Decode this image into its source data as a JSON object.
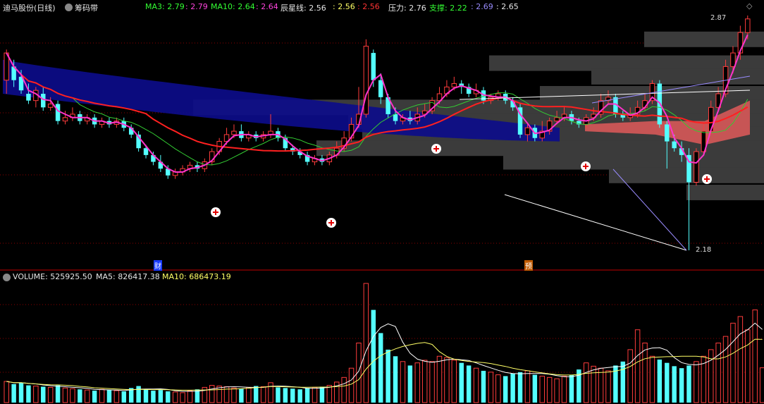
{
  "header": {
    "stock_name": "迪马股份(日线)",
    "indicator_name": "筹码带",
    "ma3_label": "MA3: 2.79",
    "ma3_value": ": 2.79",
    "ma10_label": "MA10: 2.64",
    "ma10_value": ": 2.64",
    "chenxing_label": "辰星线: 2.56",
    "chenxing_v1": ": 2.56",
    "chenxing_v2": ": 2.56",
    "pressure_label": "压力: 2.76",
    "support_label": "支撑: 2.22",
    "support_v1": ": 2.69",
    "support_v2": ": 2.65"
  },
  "volume_header": {
    "volume_label": "VOLUME: 525925.50",
    "ma5_label": "MA5: 826417.38",
    "ma10_label": "MA10: 686473.19"
  },
  "annotations": {
    "high_price": "2.87",
    "low_price": "2.18",
    "tag_cai": "财",
    "tag_yu": "预"
  },
  "colors": {
    "up": "#ff3c3c",
    "down": "#54ffff",
    "ma3": "#ff33cc",
    "ma10_green": "#33cc33",
    "chenxing": "#ff2020",
    "chip_band": "#0c0c8c",
    "volume_ma5": "#ffffff",
    "volume_ma10": "#ffff66",
    "grid": "#8b0000"
  },
  "chart_data": {
    "type": "candlestick",
    "title": "迪马股份(日线)",
    "price_range": [
      2.18,
      2.87
    ],
    "candles": [
      {
        "o": 2.68,
        "c": 2.76,
        "h": 2.77,
        "l": 2.64
      },
      {
        "o": 2.72,
        "c": 2.68,
        "h": 2.74,
        "l": 2.66
      },
      {
        "o": 2.69,
        "c": 2.65,
        "h": 2.71,
        "l": 2.64
      },
      {
        "o": 2.64,
        "c": 2.62,
        "h": 2.67,
        "l": 2.61
      },
      {
        "o": 2.62,
        "c": 2.65,
        "h": 2.66,
        "l": 2.6
      },
      {
        "o": 2.64,
        "c": 2.6,
        "h": 2.66,
        "l": 2.59
      },
      {
        "o": 2.6,
        "c": 2.61,
        "h": 2.63,
        "l": 2.59
      },
      {
        "o": 2.61,
        "c": 2.56,
        "h": 2.62,
        "l": 2.55
      },
      {
        "o": 2.56,
        "c": 2.57,
        "h": 2.59,
        "l": 2.55
      },
      {
        "o": 2.57,
        "c": 2.58,
        "h": 2.6,
        "l": 2.56
      },
      {
        "o": 2.58,
        "c": 2.56,
        "h": 2.59,
        "l": 2.55
      },
      {
        "o": 2.56,
        "c": 2.57,
        "h": 2.58,
        "l": 2.55
      },
      {
        "o": 2.57,
        "c": 2.55,
        "h": 2.58,
        "l": 2.54
      },
      {
        "o": 2.55,
        "c": 2.56,
        "h": 2.57,
        "l": 2.54
      },
      {
        "o": 2.56,
        "c": 2.55,
        "h": 2.57,
        "l": 2.54
      },
      {
        "o": 2.55,
        "c": 2.56,
        "h": 2.57,
        "l": 2.54
      },
      {
        "o": 2.56,
        "c": 2.54,
        "h": 2.57,
        "l": 2.53
      },
      {
        "o": 2.54,
        "c": 2.52,
        "h": 2.55,
        "l": 2.51
      },
      {
        "o": 2.52,
        "c": 2.48,
        "h": 2.53,
        "l": 2.47
      },
      {
        "o": 2.48,
        "c": 2.46,
        "h": 2.49,
        "l": 2.45
      },
      {
        "o": 2.46,
        "c": 2.44,
        "h": 2.47,
        "l": 2.43
      },
      {
        "o": 2.44,
        "c": 2.42,
        "h": 2.46,
        "l": 2.41
      },
      {
        "o": 2.42,
        "c": 2.4,
        "h": 2.43,
        "l": 2.39
      },
      {
        "o": 2.4,
        "c": 2.41,
        "h": 2.42,
        "l": 2.39
      },
      {
        "o": 2.41,
        "c": 2.42,
        "h": 2.43,
        "l": 2.4
      },
      {
        "o": 2.42,
        "c": 2.43,
        "h": 2.44,
        "l": 2.41
      },
      {
        "o": 2.43,
        "c": 2.42,
        "h": 2.44,
        "l": 2.41
      },
      {
        "o": 2.42,
        "c": 2.44,
        "h": 2.45,
        "l": 2.41
      },
      {
        "o": 2.44,
        "c": 2.47,
        "h": 2.48,
        "l": 2.43
      },
      {
        "o": 2.47,
        "c": 2.5,
        "h": 2.51,
        "l": 2.46
      },
      {
        "o": 2.5,
        "c": 2.52,
        "h": 2.54,
        "l": 2.49
      },
      {
        "o": 2.52,
        "c": 2.53,
        "h": 2.55,
        "l": 2.51
      },
      {
        "o": 2.53,
        "c": 2.51,
        "h": 2.55,
        "l": 2.5
      },
      {
        "o": 2.51,
        "c": 2.52,
        "h": 2.53,
        "l": 2.5
      },
      {
        "o": 2.52,
        "c": 2.51,
        "h": 2.53,
        "l": 2.5
      },
      {
        "o": 2.51,
        "c": 2.52,
        "h": 2.53,
        "l": 2.5
      },
      {
        "o": 2.52,
        "c": 2.53,
        "h": 2.58,
        "l": 2.51
      },
      {
        "o": 2.53,
        "c": 2.51,
        "h": 2.54,
        "l": 2.5
      },
      {
        "o": 2.51,
        "c": 2.48,
        "h": 2.52,
        "l": 2.47
      },
      {
        "o": 2.48,
        "c": 2.47,
        "h": 2.49,
        "l": 2.46
      },
      {
        "o": 2.47,
        "c": 2.46,
        "h": 2.48,
        "l": 2.45
      },
      {
        "o": 2.46,
        "c": 2.44,
        "h": 2.47,
        "l": 2.43
      },
      {
        "o": 2.44,
        "c": 2.45,
        "h": 2.46,
        "l": 2.43
      },
      {
        "o": 2.45,
        "c": 2.44,
        "h": 2.46,
        "l": 2.43
      },
      {
        "o": 2.44,
        "c": 2.46,
        "h": 2.47,
        "l": 2.43
      },
      {
        "o": 2.46,
        "c": 2.48,
        "h": 2.5,
        "l": 2.45
      },
      {
        "o": 2.48,
        "c": 2.51,
        "h": 2.53,
        "l": 2.47
      },
      {
        "o": 2.51,
        "c": 2.55,
        "h": 2.57,
        "l": 2.5
      },
      {
        "o": 2.55,
        "c": 2.58,
        "h": 2.66,
        "l": 2.54
      },
      {
        "o": 2.58,
        "c": 2.78,
        "h": 2.8,
        "l": 2.57
      },
      {
        "o": 2.76,
        "c": 2.68,
        "h": 2.77,
        "l": 2.66
      },
      {
        "o": 2.68,
        "c": 2.63,
        "h": 2.7,
        "l": 2.61
      },
      {
        "o": 2.63,
        "c": 2.58,
        "h": 2.64,
        "l": 2.57
      },
      {
        "o": 2.58,
        "c": 2.56,
        "h": 2.6,
        "l": 2.55
      },
      {
        "o": 2.56,
        "c": 2.57,
        "h": 2.58,
        "l": 2.55
      },
      {
        "o": 2.57,
        "c": 2.56,
        "h": 2.59,
        "l": 2.55
      },
      {
        "o": 2.56,
        "c": 2.58,
        "h": 2.6,
        "l": 2.55
      },
      {
        "o": 2.58,
        "c": 2.59,
        "h": 2.61,
        "l": 2.57
      },
      {
        "o": 2.59,
        "c": 2.62,
        "h": 2.63,
        "l": 2.58
      },
      {
        "o": 2.62,
        "c": 2.64,
        "h": 2.66,
        "l": 2.61
      },
      {
        "o": 2.64,
        "c": 2.66,
        "h": 2.68,
        "l": 2.63
      },
      {
        "o": 2.66,
        "c": 2.67,
        "h": 2.69,
        "l": 2.65
      },
      {
        "o": 2.67,
        "c": 2.66,
        "h": 2.68,
        "l": 2.64
      },
      {
        "o": 2.66,
        "c": 2.64,
        "h": 2.67,
        "l": 2.63
      },
      {
        "o": 2.64,
        "c": 2.65,
        "h": 2.67,
        "l": 2.63
      },
      {
        "o": 2.65,
        "c": 2.62,
        "h": 2.66,
        "l": 2.61
      },
      {
        "o": 2.62,
        "c": 2.63,
        "h": 2.64,
        "l": 2.61
      },
      {
        "o": 2.63,
        "c": 2.64,
        "h": 2.65,
        "l": 2.62
      },
      {
        "o": 2.64,
        "c": 2.62,
        "h": 2.65,
        "l": 2.61
      },
      {
        "o": 2.62,
        "c": 2.6,
        "h": 2.63,
        "l": 2.59
      },
      {
        "o": 2.6,
        "c": 2.52,
        "h": 2.61,
        "l": 2.51
      },
      {
        "o": 2.52,
        "c": 2.54,
        "h": 2.55,
        "l": 2.5
      },
      {
        "o": 2.54,
        "c": 2.51,
        "h": 2.55,
        "l": 2.5
      },
      {
        "o": 2.51,
        "c": 2.53,
        "h": 2.56,
        "l": 2.5
      },
      {
        "o": 2.53,
        "c": 2.56,
        "h": 2.57,
        "l": 2.52
      },
      {
        "o": 2.56,
        "c": 2.57,
        "h": 2.59,
        "l": 2.55
      },
      {
        "o": 2.57,
        "c": 2.58,
        "h": 2.6,
        "l": 2.56
      },
      {
        "o": 2.58,
        "c": 2.56,
        "h": 2.59,
        "l": 2.55
      },
      {
        "o": 2.56,
        "c": 2.55,
        "h": 2.57,
        "l": 2.54
      },
      {
        "o": 2.55,
        "c": 2.57,
        "h": 2.58,
        "l": 2.54
      },
      {
        "o": 2.57,
        "c": 2.58,
        "h": 2.6,
        "l": 2.56
      },
      {
        "o": 2.58,
        "c": 2.62,
        "h": 2.64,
        "l": 2.57
      },
      {
        "o": 2.62,
        "c": 2.63,
        "h": 2.65,
        "l": 2.61
      },
      {
        "o": 2.63,
        "c": 2.58,
        "h": 2.64,
        "l": 2.57
      },
      {
        "o": 2.58,
        "c": 2.57,
        "h": 2.59,
        "l": 2.56
      },
      {
        "o": 2.57,
        "c": 2.58,
        "h": 2.6,
        "l": 2.56
      },
      {
        "o": 2.58,
        "c": 2.6,
        "h": 2.62,
        "l": 2.57
      },
      {
        "o": 2.6,
        "c": 2.62,
        "h": 2.64,
        "l": 2.59
      },
      {
        "o": 2.62,
        "c": 2.67,
        "h": 2.68,
        "l": 2.61
      },
      {
        "o": 2.67,
        "c": 2.55,
        "h": 2.68,
        "l": 2.54
      },
      {
        "o": 2.55,
        "c": 2.5,
        "h": 2.56,
        "l": 2.42
      },
      {
        "o": 2.5,
        "c": 2.48,
        "h": 2.52,
        "l": 2.47
      },
      {
        "o": 2.48,
        "c": 2.46,
        "h": 2.5,
        "l": 2.44
      },
      {
        "o": 2.46,
        "c": 2.38,
        "h": 2.48,
        "l": 2.18
      },
      {
        "o": 2.38,
        "c": 2.47,
        "h": 2.48,
        "l": 2.37
      },
      {
        "o": 2.47,
        "c": 2.53,
        "h": 2.55,
        "l": 2.46
      },
      {
        "o": 2.53,
        "c": 2.6,
        "h": 2.62,
        "l": 2.52
      },
      {
        "o": 2.6,
        "c": 2.64,
        "h": 2.66,
        "l": 2.59
      },
      {
        "o": 2.64,
        "c": 2.72,
        "h": 2.74,
        "l": 2.63
      },
      {
        "o": 2.72,
        "c": 2.76,
        "h": 2.78,
        "l": 2.7
      },
      {
        "o": 2.76,
        "c": 2.82,
        "h": 2.84,
        "l": 2.74
      },
      {
        "o": 2.82,
        "c": 2.86,
        "h": 2.87,
        "l": 2.8
      }
    ],
    "volume": [
      320000,
      280000,
      300000,
      260000,
      250000,
      240000,
      230000,
      260000,
      220000,
      210000,
      200000,
      190000,
      180000,
      200000,
      190000,
      180000,
      170000,
      220000,
      250000,
      200000,
      180000,
      190000,
      170000,
      160000,
      150000,
      180000,
      200000,
      230000,
      260000,
      250000,
      240000,
      220000,
      210000,
      230000,
      250000,
      240000,
      300000,
      230000,
      220000,
      210000,
      200000,
      220000,
      230000,
      240000,
      260000,
      310000,
      380000,
      520000,
      900000,
      1800000,
      1400000,
      1050000,
      800000,
      700000,
      620000,
      560000,
      600000,
      640000,
      620000,
      700000,
      680000,
      640000,
      600000,
      560000,
      520000,
      480000,
      460000,
      420000,
      400000,
      440000,
      460000,
      480000,
      420000,
      400000,
      380000,
      360000,
      400000,
      420000,
      500000,
      600000,
      550000,
      520000,
      480000,
      560000,
      620000,
      800000,
      1100000,
      900000,
      700000,
      650000,
      600000,
      550000,
      520000,
      560000,
      620000,
      700000,
      800000,
      900000,
      1000000,
      1200000,
      1300000,
      1100000,
      1400000,
      525925
    ],
    "volume_ma5_last": 826417.38,
    "volume_ma10_last": 686473.19
  }
}
